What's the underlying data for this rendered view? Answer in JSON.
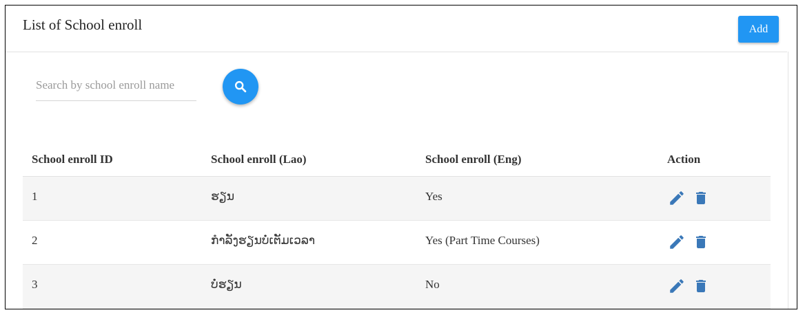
{
  "header": {
    "title": "List of School enroll",
    "add_label": "Add"
  },
  "search": {
    "placeholder": "Search by school enroll name",
    "value": "",
    "icon": "search-icon"
  },
  "table": {
    "columns": [
      "School enroll ID",
      "School enroll (Lao)",
      "School enroll (Eng)",
      "Action"
    ],
    "rows": [
      {
        "id": "1",
        "lao": "ຮຽນ",
        "eng": "Yes"
      },
      {
        "id": "2",
        "lao": "ກໍາລັງຮຽນບໍ່ເຕັມເວລາ",
        "eng": "Yes (Part Time Courses)"
      },
      {
        "id": "3",
        "lao": "ບໍ່ຮຽນ",
        "eng": "No"
      }
    ],
    "action_icons": [
      "edit-icon",
      "delete-icon"
    ]
  },
  "colors": {
    "accent": "#2196f3",
    "action_icon": "#3a78b8",
    "row_shade": "#f5f5f5"
  }
}
